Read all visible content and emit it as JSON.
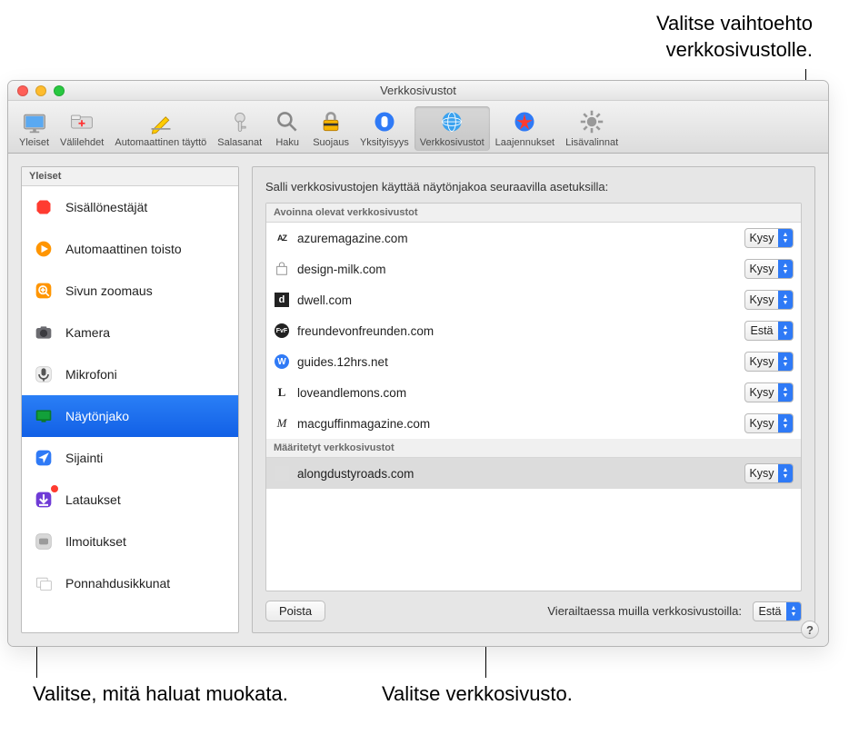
{
  "callouts": {
    "top": "Valitse vaihtoehto\nverkkosivustolle.",
    "bottom_left": "Valitse, mitä haluat muokata.",
    "bottom_center": "Valitse verkkosivusto."
  },
  "window": {
    "title": "Verkkosivustot"
  },
  "toolbar": [
    {
      "id": "general",
      "label": "Yleiset"
    },
    {
      "id": "tabs",
      "label": "Välilehdet"
    },
    {
      "id": "autofill",
      "label": "Automaattinen täyttö"
    },
    {
      "id": "passwords",
      "label": "Salasanat"
    },
    {
      "id": "search",
      "label": "Haku"
    },
    {
      "id": "security",
      "label": "Suojaus"
    },
    {
      "id": "privacy",
      "label": "Yksityisyys"
    },
    {
      "id": "websites",
      "label": "Verkkosivustot",
      "selected": true
    },
    {
      "id": "extensions",
      "label": "Laajennukset"
    },
    {
      "id": "advanced",
      "label": "Lisävalinnat"
    }
  ],
  "sidebar": {
    "header": "Yleiset",
    "items": [
      {
        "id": "content-blockers",
        "label": "Sisällönestäjät",
        "color": "#ff3b30"
      },
      {
        "id": "autoplay",
        "label": "Automaattinen toisto",
        "color": "#ff9500"
      },
      {
        "id": "page-zoom",
        "label": "Sivun zoomaus",
        "color": "#ff9500"
      },
      {
        "id": "camera",
        "label": "Kamera",
        "color": "#8e8e93"
      },
      {
        "id": "microphone",
        "label": "Mikrofoni",
        "color": "#8e8e93"
      },
      {
        "id": "screen-share",
        "label": "Näytönjako",
        "color": "#0b7a2a",
        "selected": true
      },
      {
        "id": "location",
        "label": "Sijainti",
        "color": "#2f7af6"
      },
      {
        "id": "downloads",
        "label": "Lataukset",
        "color": "#6f3bd6",
        "badge": true
      },
      {
        "id": "notifications",
        "label": "Ilmoitukset",
        "color": "#c8c8c8"
      },
      {
        "id": "popups",
        "label": "Ponnahdusikkunat",
        "color": "#e6e6e6"
      }
    ]
  },
  "main": {
    "message": "Salli verkkosivustojen käyttää näytönjakoa seuraavilla asetuksilla:",
    "open_header": "Avoinna olevat verkkosivustot",
    "configured_header": "Määritetyt verkkosivustot",
    "options": {
      "ask": "Kysy",
      "deny": "Estä"
    },
    "open_sites": [
      {
        "site": "azuremagazine.com",
        "opt": "Kysy",
        "fav": "AZ"
      },
      {
        "site": "design-milk.com",
        "opt": "Kysy",
        "fav": "bag"
      },
      {
        "site": "dwell.com",
        "opt": "Kysy",
        "fav": "d"
      },
      {
        "site": "freundevonfreunden.com",
        "opt": "Estä",
        "fav": "fvf"
      },
      {
        "site": "guides.12hrs.net",
        "opt": "Kysy",
        "fav": "w"
      },
      {
        "site": "loveandlemons.com",
        "opt": "Kysy",
        "fav": "L"
      },
      {
        "site": "macguffinmagazine.com",
        "opt": "Kysy",
        "fav": "M"
      }
    ],
    "configured_sites": [
      {
        "site": "alongdustyroads.com",
        "opt": "Kysy",
        "selected": true
      }
    ],
    "remove_btn": "Poista",
    "other_label": "Vierailtaessa muilla verkkosivustoilla:",
    "other_opt": "Estä"
  }
}
